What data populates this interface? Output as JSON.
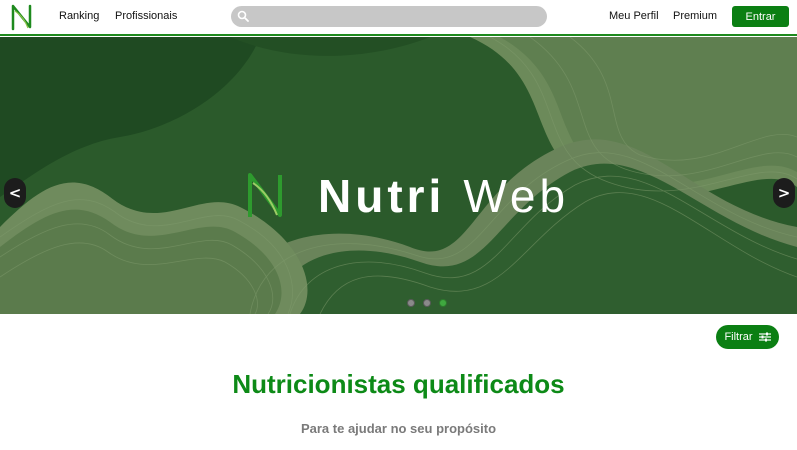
{
  "header": {
    "nav": {
      "ranking": "Ranking",
      "profissionais": "Profissionais",
      "meu_perfil": "Meu Perfil",
      "premium": "Premium"
    },
    "search": {
      "value": "",
      "placeholder": ""
    },
    "login_label": "Entrar",
    "logo_icon": "nutriweb-n-logo"
  },
  "hero": {
    "brand_bold": "Nutri",
    "brand_light": "Web",
    "prev_label": "<",
    "next_label": ">",
    "slides_count": 3,
    "active_slide": 3,
    "colors": {
      "bg": "#2c5a2c",
      "contour": "#6a845a",
      "accent": "#3fa83f"
    }
  },
  "filter": {
    "label": "Filtrar",
    "icon": "sliders-icon"
  },
  "main": {
    "title": "Nutricionistas qualificados",
    "subtitle": "Para te ajudar no seu propósito"
  },
  "colors": {
    "brand_green": "#0b7f13",
    "title_green": "#0d8a17",
    "subtitle_gray": "#7a7a7a"
  }
}
